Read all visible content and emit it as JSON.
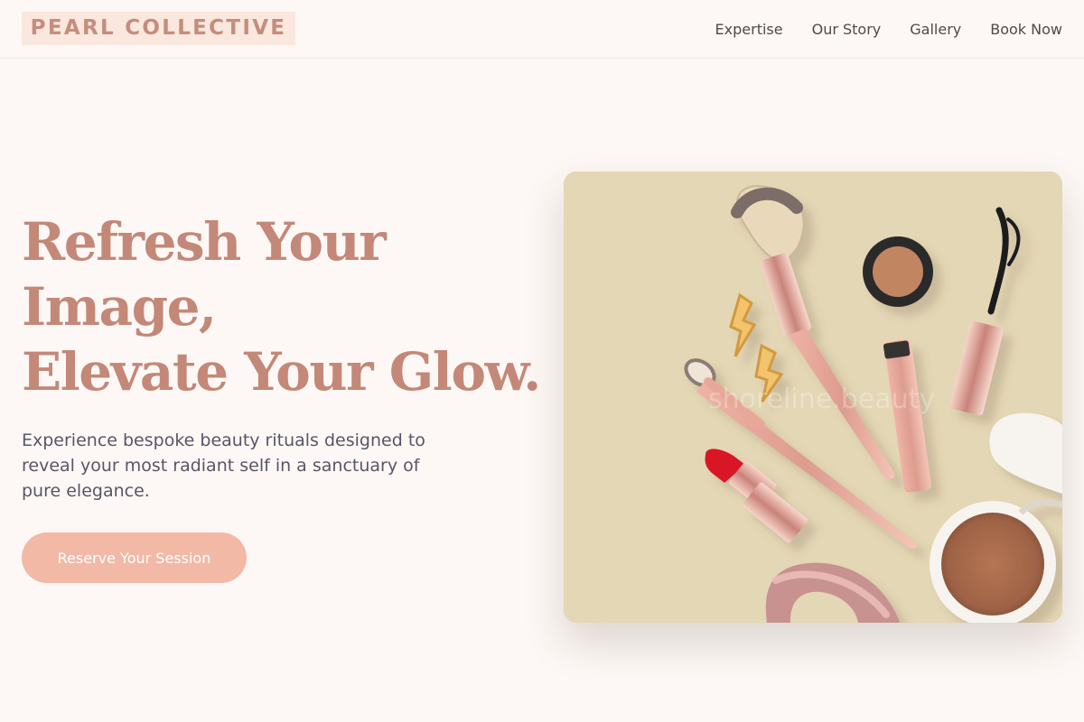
{
  "brand": {
    "name": "PEARL COLLECTIVE"
  },
  "nav": {
    "items": [
      {
        "label": "Expertise"
      },
      {
        "label": "Our Story"
      },
      {
        "label": "Gallery"
      },
      {
        "label": "Book Now"
      }
    ]
  },
  "hero": {
    "title_lines": [
      "Refresh Your",
      "Image,",
      "Elevate Your Glow."
    ],
    "description": "Experience bespoke beauty rituals designed to reveal your most radiant self in a sanctuary of pure elegance.",
    "cta_label": "Reserve Your Session",
    "image_watermark": "shoreline.beauty"
  },
  "colors": {
    "page_background": "#fdf8f5",
    "brand_background": "#fae7de",
    "brand_text": "#c48d7d",
    "headline": "#c38878",
    "body_text": "#585666",
    "cta_background": "#f2b9a6",
    "image_background": "#e4d7b5"
  }
}
